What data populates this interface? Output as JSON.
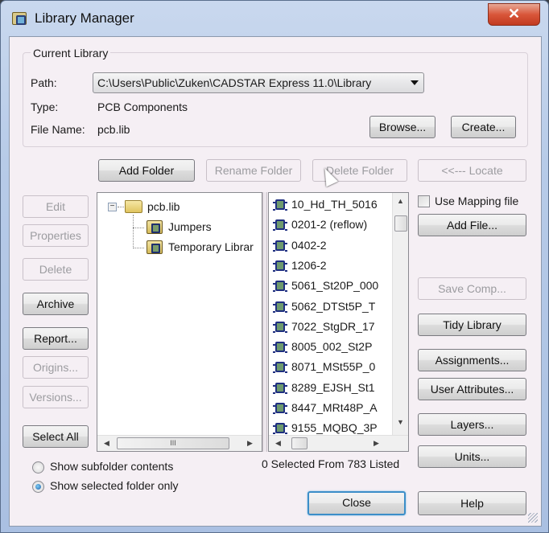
{
  "window": {
    "title": "Library Manager",
    "close_glyph": "✕"
  },
  "current_library": {
    "group_label": "Current Library",
    "path_label": "Path:",
    "path_value": "C:\\Users\\Public\\Zuken\\CADSTAR Express 11.0\\Library",
    "type_label": "Type:",
    "type_value": "PCB Components",
    "filename_label": "File Name:",
    "filename_value": "pcb.lib",
    "browse_label": "Browse...",
    "create_label": "Create..."
  },
  "folder_toolbar": {
    "add_folder": "Add Folder",
    "rename_folder": "Rename Folder",
    "delete_folder": "Delete Folder",
    "locate": "<<--- Locate"
  },
  "left_buttons": {
    "edit": "Edit",
    "properties": "Properties",
    "delete": "Delete",
    "archive": "Archive",
    "report": "Report...",
    "origins": "Origins...",
    "versions": "Versions...",
    "select_all": "Select All"
  },
  "tree": {
    "root": {
      "label": "pcb.lib",
      "expander": "−"
    },
    "children": [
      {
        "label": "Jumpers"
      },
      {
        "label": "Temporary Librar"
      }
    ],
    "hscroll_grip": "III"
  },
  "components": [
    "10_Hd_TH_5016",
    "0201-2 (reflow)",
    "0402-2",
    "1206-2",
    "5061_St20P_000",
    "5062_DTSt5P_T",
    "7022_StgDR_17",
    "8005_002_St2P",
    "8071_MSt55P_0",
    "8289_EJSH_St1",
    "8447_MRt48P_A",
    "9155_MQBQ_3P"
  ],
  "right_buttons": {
    "use_mapping_file": "Use Mapping file",
    "use_mapping_checked": false,
    "add_file": "Add File...",
    "save_comp": "Save Comp...",
    "tidy_library": "Tidy Library",
    "assignments": "Assignments...",
    "user_attributes": "User Attributes...",
    "layers": "Layers...",
    "units": "Units..."
  },
  "options": {
    "show_subfolder": "Show subfolder contents",
    "show_selected_only": "Show selected folder only",
    "selected": "show_selected_only"
  },
  "status": {
    "selection_text": "0 Selected From 783 Listed"
  },
  "footer": {
    "close": "Close",
    "help": "Help"
  },
  "scroll_glyphs": {
    "up": "▲",
    "down": "▼",
    "left": "◀",
    "right": "▶"
  }
}
